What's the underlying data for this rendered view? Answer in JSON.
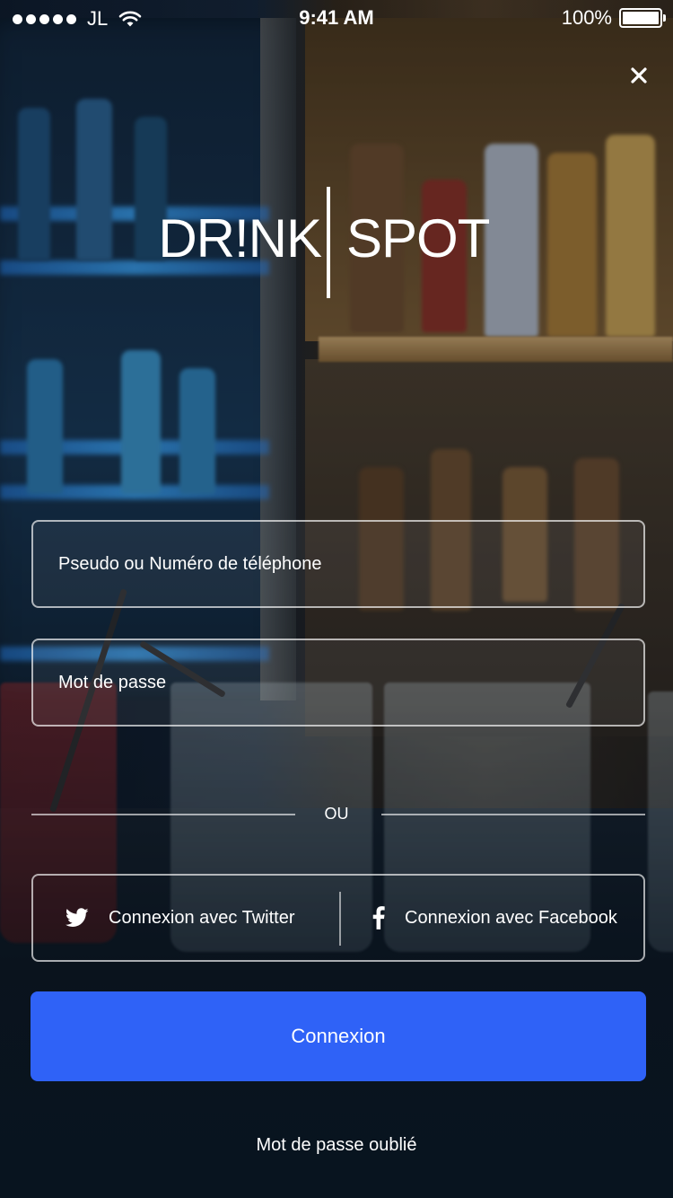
{
  "status_bar": {
    "carrier": "JL",
    "time": "9:41 AM",
    "battery": "100%"
  },
  "logo": {
    "left": "DR!NK",
    "right": "SPOT"
  },
  "form": {
    "username_placeholder": "Pseudo ou Numéro de téléphone",
    "password_placeholder": "Mot de passe",
    "divider_label": "OU",
    "twitter_label": "Connexion avec Twitter",
    "facebook_label": "Connexion avec Facebook",
    "submit_label": "Connexion",
    "forgot_label": "Mot de passe oublié"
  },
  "icons": {
    "close": "close-icon",
    "twitter": "twitter-icon",
    "facebook": "facebook-icon",
    "wifi": "wifi-icon",
    "battery": "battery-icon"
  },
  "colors": {
    "primary_button": "#2f62f7",
    "text": "#ffffff"
  }
}
